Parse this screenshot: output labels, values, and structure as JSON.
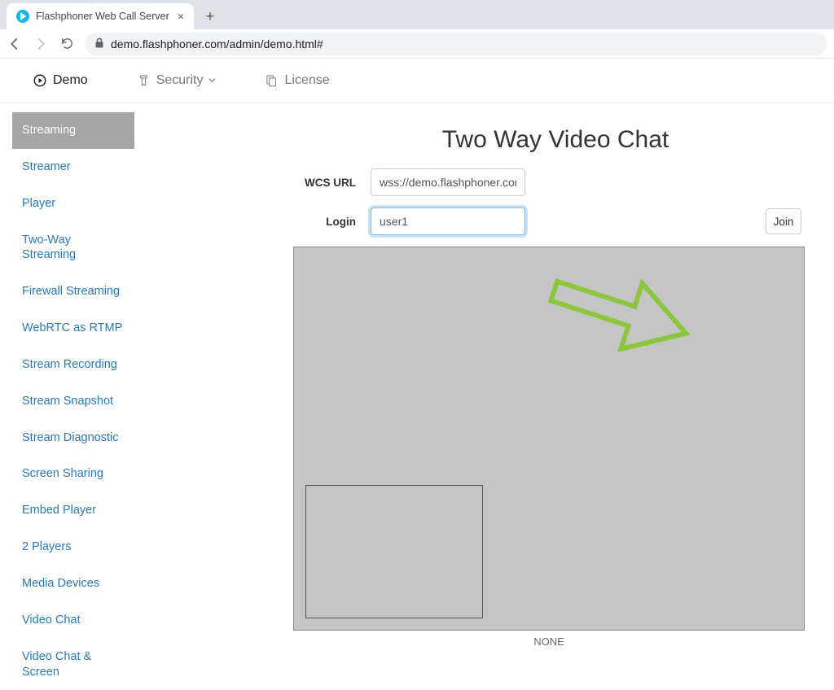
{
  "browser": {
    "tab_title": "Flashphoner Web Call Server",
    "url_display": "demo.flashphoner.com/admin/demo.html#"
  },
  "topnav": {
    "demo": "Demo",
    "security": "Security",
    "license": "License"
  },
  "sidebar": {
    "items": [
      "Streaming",
      "Streamer",
      "Player",
      "Two-Way Streaming",
      "Firewall Streaming",
      "WebRTC as RTMP",
      "Stream Recording",
      "Stream Snapshot",
      "Stream Diagnostic",
      "Screen Sharing",
      "Embed Player",
      "2 Players",
      "Media Devices",
      "Video Chat",
      "Video Chat & Screen"
    ]
  },
  "page": {
    "title": "Two Way Video Chat",
    "wcs_label": "WCS URL",
    "wcs_value": "wss://demo.flashphoner.com",
    "login_label": "Login",
    "login_value": "user1",
    "join_label": "Join",
    "video_status": "NONE"
  }
}
